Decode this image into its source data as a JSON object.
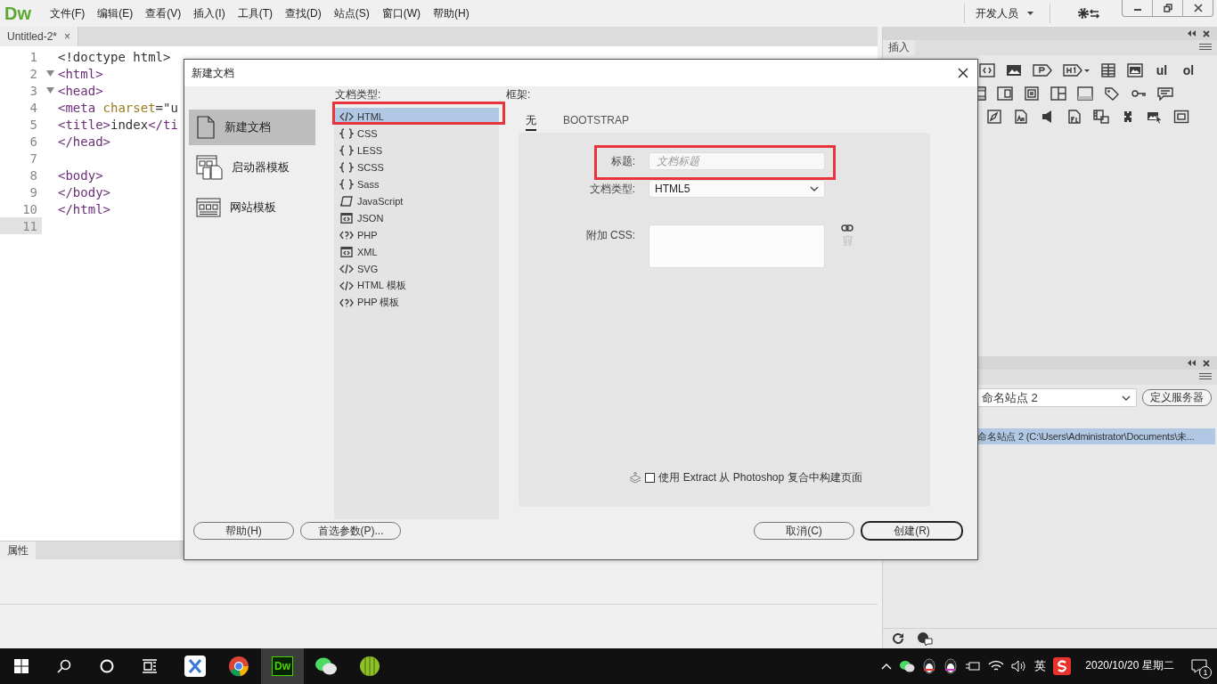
{
  "app": {
    "logo": "Dw",
    "menus": [
      "文件(F)",
      "编辑(E)",
      "查看(V)",
      "插入(I)",
      "工具(T)",
      "查找(D)",
      "站点(S)",
      "窗口(W)",
      "帮助(H)"
    ],
    "workspace": "开发人员"
  },
  "document_tab": {
    "title": "Untitled-2*",
    "close": "×"
  },
  "code_lines": [
    {
      "number": "1",
      "foldable": false,
      "current": false,
      "tokens": [
        {
          "kind": "plain",
          "text": "<!doctype html>"
        }
      ]
    },
    {
      "number": "2",
      "foldable": true,
      "current": false,
      "tokens": [
        {
          "kind": "tag",
          "text": "<html>"
        }
      ]
    },
    {
      "number": "3",
      "foldable": true,
      "current": false,
      "tokens": [
        {
          "kind": "tag",
          "text": "<head>"
        }
      ]
    },
    {
      "number": "4",
      "foldable": false,
      "current": false,
      "tokens": [
        {
          "kind": "tag",
          "text": "<meta "
        },
        {
          "kind": "attr",
          "text": "charset"
        },
        {
          "kind": "plain",
          "text": "=\"u"
        }
      ]
    },
    {
      "number": "5",
      "foldable": false,
      "current": false,
      "tokens": [
        {
          "kind": "tag",
          "text": "<title>"
        },
        {
          "kind": "plain",
          "text": "index"
        },
        {
          "kind": "tag",
          "text": "</ti"
        }
      ]
    },
    {
      "number": "6",
      "foldable": false,
      "current": false,
      "tokens": [
        {
          "kind": "tag",
          "text": "</head>"
        }
      ]
    },
    {
      "number": "7",
      "foldable": false,
      "current": false
    },
    {
      "number": "8",
      "foldable": false,
      "current": false,
      "tokens": [
        {
          "kind": "tag",
          "text": "<body>"
        }
      ]
    },
    {
      "number": "9",
      "foldable": false,
      "current": false,
      "tokens": [
        {
          "kind": "tag",
          "text": "</body>"
        }
      ]
    },
    {
      "number": "10",
      "foldable": false,
      "current": false,
      "tokens": [
        {
          "kind": "tag",
          "text": "</html>"
        }
      ]
    },
    {
      "number": "11",
      "foldable": false,
      "current": true
    }
  ],
  "properties_panel": {
    "tab": "属性"
  },
  "insert_panel": {
    "tab": "插入",
    "text_items": [
      "ul",
      "ol"
    ]
  },
  "files_panel": {
    "site": "命名站点 2",
    "define_button": "定义服务器",
    "rows": [
      {
        "label": "命名站点 2 (C:\\Users\\Administrator\\Documents\\未...",
        "selected": true
      }
    ]
  },
  "dialog": {
    "title": "新建文档",
    "nav": [
      {
        "label": "新建文档",
        "selected": true
      },
      {
        "label": "启动器模板",
        "selected": false
      },
      {
        "label": "网站模板",
        "selected": false
      }
    ],
    "doc_type_label": "文档类型:",
    "doc_types": [
      {
        "label": "HTML",
        "kind": "markup",
        "selected": true
      },
      {
        "label": "CSS",
        "kind": "braces",
        "selected": false
      },
      {
        "label": "LESS",
        "kind": "braces",
        "selected": false
      },
      {
        "label": "SCSS",
        "kind": "braces",
        "selected": false
      },
      {
        "label": "Sass",
        "kind": "braces",
        "selected": false
      },
      {
        "label": "JavaScript",
        "kind": "script",
        "selected": false
      },
      {
        "label": "JSON",
        "kind": "data",
        "selected": false
      },
      {
        "label": "PHP",
        "kind": "php",
        "selected": false
      },
      {
        "label": "XML",
        "kind": "data",
        "selected": false
      },
      {
        "label": "SVG",
        "kind": "markup",
        "selected": false
      },
      {
        "label": "HTML 模板",
        "kind": "markup",
        "selected": false
      },
      {
        "label": "PHP 模板",
        "kind": "php",
        "selected": false
      }
    ],
    "framework_label": "框架:",
    "framework_tabs": [
      {
        "label": "无",
        "selected": true
      },
      {
        "label": "BOOTSTRAP",
        "selected": false
      }
    ],
    "title_field": {
      "label": "标题:",
      "placeholder": "文档标题"
    },
    "doctype_field": {
      "label": "文档类型:",
      "value": "HTML5"
    },
    "css_field": {
      "label": "附加 CSS:"
    },
    "extract": {
      "label": "使用 Extract 从 Photoshop 复合中构建页面",
      "checked": false
    },
    "buttons_left": [
      {
        "label": "帮助(H)",
        "default": false
      },
      {
        "label": "首选参数(P)...",
        "default": false
      }
    ],
    "buttons_right": [
      {
        "label": "取消(C)",
        "default": false
      },
      {
        "label": "创建(R)",
        "default": true
      }
    ]
  },
  "taskbar": {
    "apps": [
      {
        "kind": "cross",
        "active": false
      },
      {
        "kind": "browser",
        "active": false
      },
      {
        "kind": "dw",
        "label": "Dw",
        "active": true
      },
      {
        "kind": "chat",
        "active": false
      },
      {
        "kind": "bamboo",
        "active": false
      }
    ],
    "language": "英",
    "date": "2020/10/20 星期二",
    "notifications": "1"
  }
}
